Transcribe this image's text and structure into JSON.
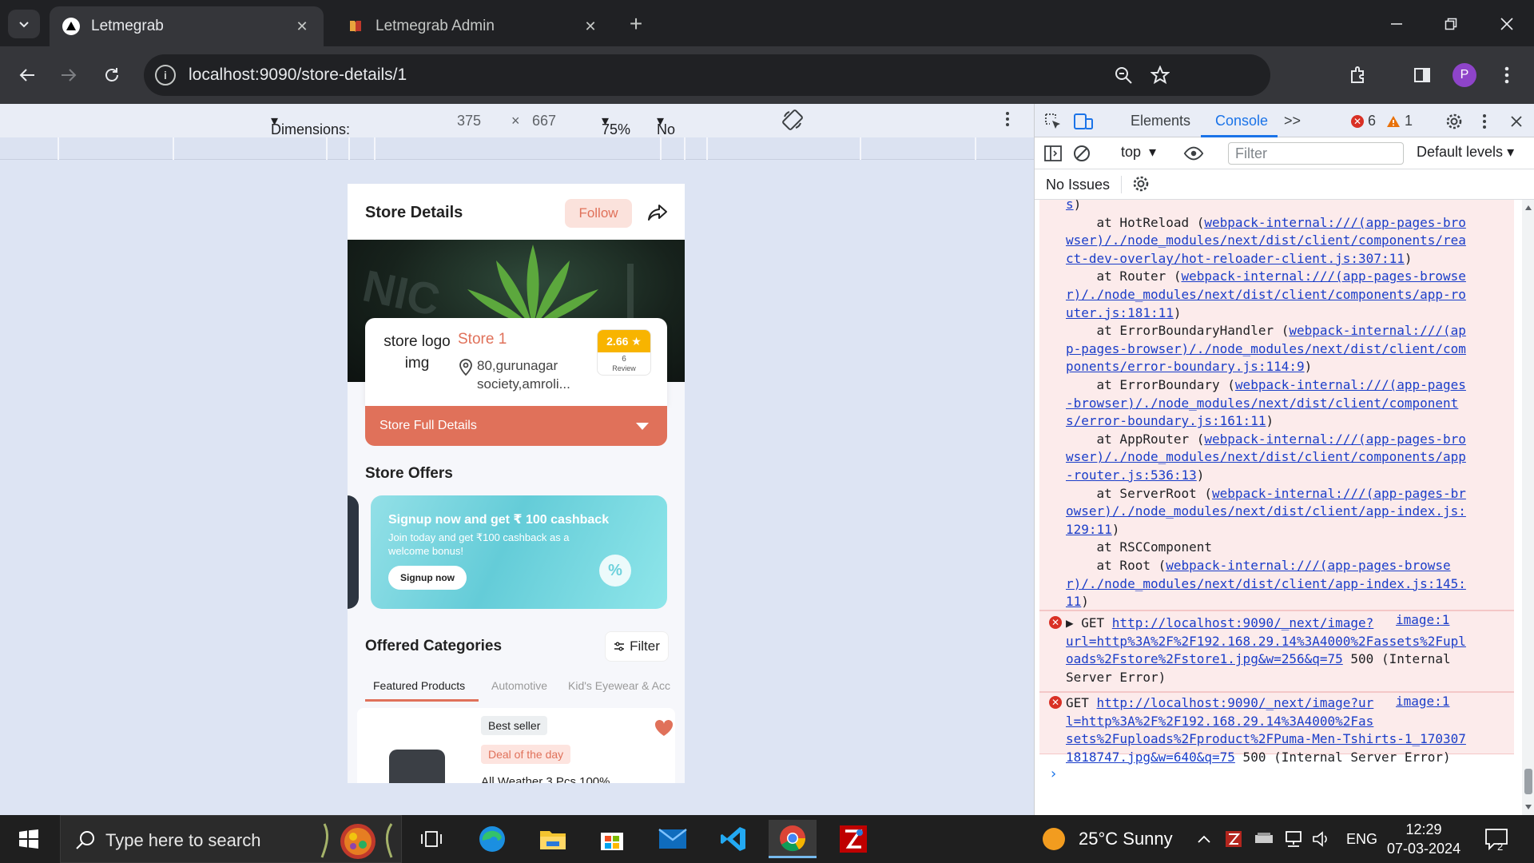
{
  "browser": {
    "tabs": [
      {
        "title": "Letmegrab",
        "active": true
      },
      {
        "title": "Letmegrab Admin",
        "active": false
      }
    ],
    "url": "localhost:9090/store-details/1",
    "profile_initial": "P"
  },
  "device_toolbar": {
    "dimensions": "Dimensions: iPhone SE",
    "width": "375",
    "times": "×",
    "height": "667",
    "zoom": "75%",
    "throttling": "No throttling"
  },
  "page": {
    "title": "Store Details",
    "follow_label": "Follow",
    "store": {
      "logo_alt": "store logo img",
      "name": "Store 1",
      "address_line1": "80,gurunagar",
      "address_line2": "society,amroli...",
      "rating": "2.66 ★",
      "review_count": "6",
      "review_label": "Review"
    },
    "full_details_label": "Store Full Details",
    "offers_title": "Store Offers",
    "offer": {
      "title": "Signup now and get ₹ 100 cashback",
      "description": "Join today and get ₹100 cashback as a welcome bonus!",
      "button": "Signup now",
      "pct": "%"
    },
    "categories_title": "Offered Categories",
    "filter_label": "Filter",
    "category_tabs": [
      "Featured Products",
      "Automotive",
      "Kid's Eyewear & Acc"
    ],
    "product": {
      "badge1": "Best seller",
      "badge2": "Deal of the day",
      "name": "All Weather 3 Pcs 100%"
    }
  },
  "devtools": {
    "tabs": {
      "elements": "Elements",
      "console": "Console",
      "more": ">>"
    },
    "errors": "6",
    "warnings": "1",
    "context": "top",
    "filter_placeholder": "Filter",
    "levels": "Default levels",
    "issues": "No Issues",
    "stack_lines": [
      {
        "pre": "",
        "link": "s",
        "post": ")"
      },
      {
        "pre": "    at HotReload (",
        "link": "webpack-internal:///(app-pages-bro",
        "post": ""
      },
      {
        "pre": "",
        "link": "wser)/./node_modules/next/dist/client/components/rea",
        "post": ""
      },
      {
        "pre": "",
        "link": "ct-dev-overlay/hot-reloader-client.js:307:11",
        "post": ")"
      },
      {
        "pre": "    at Router (",
        "link": "webpack-internal:///(app-pages-browse",
        "post": ""
      },
      {
        "pre": "",
        "link": "r)/./node_modules/next/dist/client/components/app-ro",
        "post": ""
      },
      {
        "pre": "",
        "link": "uter.js:181:11",
        "post": ")"
      },
      {
        "pre": "    at ErrorBoundaryHandler (",
        "link": "webpack-internal:///(ap",
        "post": ""
      },
      {
        "pre": "",
        "link": "p-pages-browser)/./node_modules/next/dist/client/com",
        "post": ""
      },
      {
        "pre": "",
        "link": "ponents/error-boundary.js:114:9",
        "post": ")"
      },
      {
        "pre": "    at ErrorBoundary (",
        "link": "webpack-internal:///(app-pages",
        "post": ""
      },
      {
        "pre": "",
        "link": "-browser)/./node_modules/next/dist/client/component",
        "post": ""
      },
      {
        "pre": "",
        "link": "s/error-boundary.js:161:11",
        "post": ")"
      },
      {
        "pre": "    at AppRouter (",
        "link": "webpack-internal:///(app-pages-bro",
        "post": ""
      },
      {
        "pre": "",
        "link": "wser)/./node_modules/next/dist/client/components/app",
        "post": ""
      },
      {
        "pre": "",
        "link": "-router.js:536:13",
        "post": ")"
      },
      {
        "pre": "    at ServerRoot (",
        "link": "webpack-internal:///(app-pages-br",
        "post": ""
      },
      {
        "pre": "",
        "link": "owser)/./node_modules/next/dist/client/app-index.js:",
        "post": ""
      },
      {
        "pre": "",
        "link": "129:11",
        "post": ")"
      },
      {
        "pre": "    at RSCComponent",
        "link": "",
        "post": ""
      },
      {
        "pre": "    at Root (",
        "link": "webpack-internal:///(app-pages-browse",
        "post": ""
      },
      {
        "pre": "",
        "link": "r)/./node_modules/next/dist/client/app-index.js:145:",
        "post": ""
      },
      {
        "pre": "",
        "link": "11",
        "post": ")"
      }
    ],
    "error1": {
      "lines": [
        {
          "pre": "▶ GET ",
          "link": "http://localhost:9090/_next/image?",
          "post": ""
        },
        {
          "pre": "",
          "link": "url=http%3A%2F%2F192.168.29.14%3A4000%2Fassets%2Fupl",
          "post": ""
        },
        {
          "pre": "",
          "link": "oads%2Fstore%2Fstore1.jpg&w=256&q=75",
          "post": " 500 (Internal"
        },
        {
          "pre": "Server Error)",
          "link": "",
          "post": ""
        }
      ],
      "source": "image:1"
    },
    "error2": {
      "lines": [
        {
          "pre": "GET ",
          "link": "http://localhost:9090/_next/image?ur",
          "post": ""
        },
        {
          "pre": "",
          "link": "l=http%3A%2F%2F192.168.29.14%3A4000%2Fas",
          "post": ""
        },
        {
          "pre": "",
          "link": "sets%2Fuploads%2Fproduct%2FPuma-Men-Tshirts-1_170307",
          "post": ""
        },
        {
          "pre": "",
          "link": "1818747.jpg&w=640&q=75",
          "post": " 500 (Internal Server Error)"
        }
      ],
      "source": "image:1"
    },
    "prompt": "›"
  },
  "taskbar": {
    "search_placeholder": "Type here to search",
    "weather": "25°C  Sunny",
    "lang": "ENG",
    "time": "12:29",
    "date": "07-03-2024",
    "notif_count": "2"
  }
}
